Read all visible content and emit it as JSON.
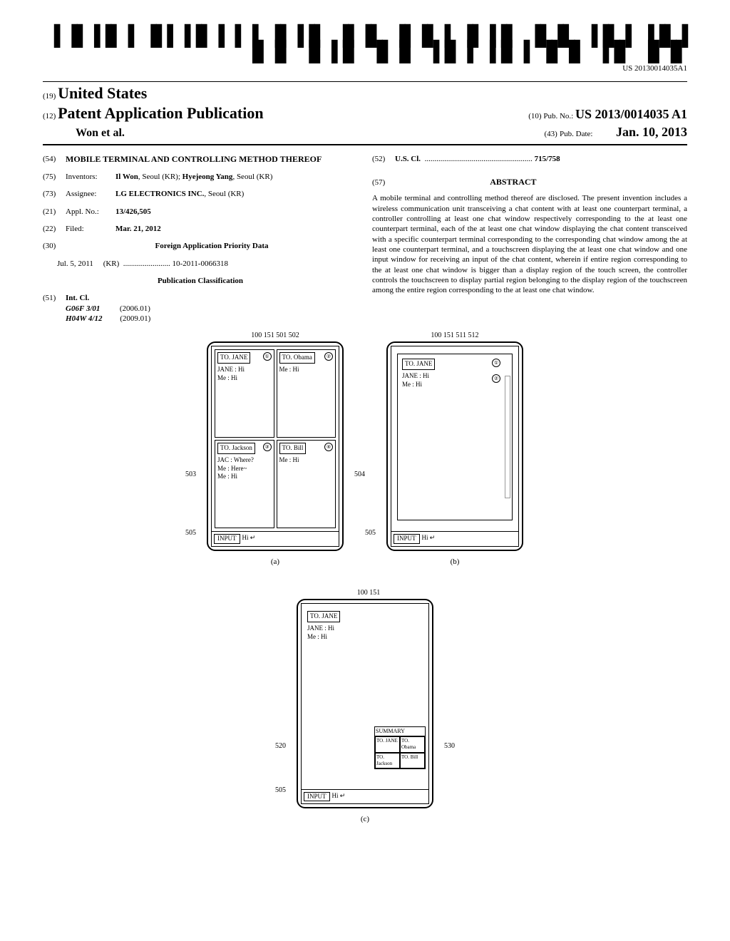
{
  "barcode_text": "US 20130014035A1",
  "country_code": "(19)",
  "country": "United States",
  "pub_code": "(12)",
  "pub_type": "Patent Application Publication",
  "authors": "Won et al.",
  "pubno_code": "(10)",
  "pubno_label": "Pub. No.:",
  "pubno": "US 2013/0014035 A1",
  "pubdate_code": "(43)",
  "pubdate_label": "Pub. Date:",
  "pubdate": "Jan. 10, 2013",
  "title_code": "(54)",
  "title": "MOBILE TERMINAL AND CONTROLLING METHOD THEREOF",
  "inventors_code": "(75)",
  "inventors_label": "Inventors:",
  "inventors_value": "Il Won, Seoul (KR); Hyejeong Yang, Seoul (KR)",
  "assignee_code": "(73)",
  "assignee_label": "Assignee:",
  "assignee_value": "LG ELECTRONICS INC., Seoul (KR)",
  "applno_code": "(21)",
  "applno_label": "Appl. No.:",
  "applno_value": "13/426,505",
  "filed_code": "(22)",
  "filed_label": "Filed:",
  "filed_value": "Mar. 21, 2012",
  "foreign_code": "(30)",
  "foreign_header": "Foreign Application Priority Data",
  "foreign_date": "Jul. 5, 2011",
  "foreign_country": "(KR)",
  "foreign_number": "10-2011-0066318",
  "pubclass_header": "Publication Classification",
  "intcl_code": "(51)",
  "intcl_label": "Int. Cl.",
  "intcl_1": "G06F 3/01",
  "intcl_1_year": "(2006.01)",
  "intcl_2": "H04W 4/12",
  "intcl_2_year": "(2009.01)",
  "uscl_code": "(52)",
  "uscl_label": "U.S. Cl.",
  "uscl_value": "715/758",
  "abstract_code": "(57)",
  "abstract_label": "ABSTRACT",
  "abstract_text": "A mobile terminal and controlling method thereof are disclosed. The present invention includes a wireless communication unit transceiving a chat content with at least one counterpart terminal, a controller controlling at least one chat window respectively corresponding to the at least one counterpart terminal, each of the at least one chat window displaying the chat content transceived with a specific counterpart terminal corresponding to the corresponding chat window among the at least one counterpart terminal, and a touchscreen displaying the at least one chat window and one input window for receiving an input of the chat content, wherein if entire region corresponding to the at least one chat window is bigger than a display region of the touch screen, the controller controls the touchscreen to display partial region belonging to the display region of the touchscreen among the entire region corresponding to the at least one chat window.",
  "fig_a": {
    "refs": "100  151  501      502",
    "windows": [
      {
        "to": "TO. JANE",
        "num": "①",
        "lines": [
          "JANE : Hi",
          "Me : Hi"
        ]
      },
      {
        "to": "TO. Obama",
        "num": "②",
        "lines": [
          "Me : Hi"
        ]
      },
      {
        "to": "TO. Jackson",
        "num": "③",
        "lines": [
          "JAC : Where?",
          "Me : Here~",
          "Me : Hi"
        ]
      },
      {
        "to": "TO. Bill",
        "num": "④",
        "lines": [
          "Me : Hi"
        ]
      }
    ],
    "input_label": "INPUT",
    "input_value": "Hi ↵",
    "left_ref_503": "503",
    "left_ref_505": "505",
    "right_ref_504": "504",
    "label": "(a)"
  },
  "fig_b": {
    "refs": "100  151  511              512",
    "window": {
      "to": "TO. JANE",
      "num1": "①",
      "num2": "②",
      "lines": [
        "JANE : Hi",
        "Me : Hi"
      ]
    },
    "input_label": "INPUT",
    "input_value": "Hi ↵",
    "left_ref_505": "505",
    "label": "(b)"
  },
  "fig_c": {
    "refs": "100  151",
    "window": {
      "to": "TO. JANE",
      "lines": [
        "JANE : Hi",
        "Me : Hi"
      ]
    },
    "summary_label": "SUMMARY",
    "summary_cells": [
      "TO. JANE",
      "TO. Obama",
      "TO. Jackson",
      "TO. Bill"
    ],
    "input_label": "INPUT",
    "input_value": "Hi ↵",
    "left_ref_520": "520",
    "left_ref_505": "505",
    "right_ref_530": "530",
    "label": "(c)"
  }
}
